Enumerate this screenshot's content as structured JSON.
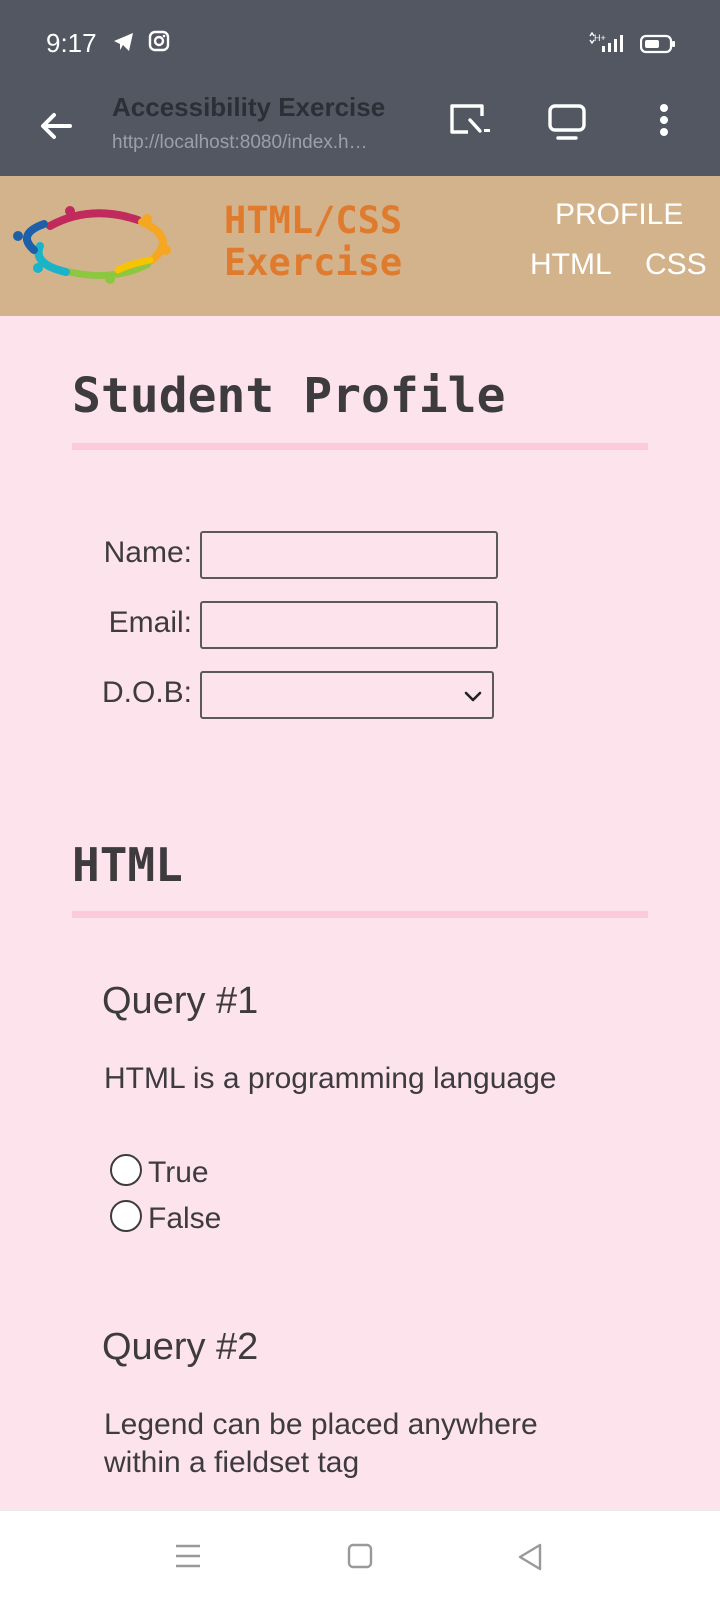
{
  "status_bar": {
    "time": "9:17",
    "icons": [
      "telegram-icon",
      "instagram-icon",
      "signal-icon",
      "battery-icon"
    ]
  },
  "browser": {
    "title": "Accessibility Exercise",
    "url": "http://localhost:8080/index.h…",
    "icons": [
      "back-arrow-icon",
      "cast-icon",
      "tab-switcher-icon",
      "more-vert-icon"
    ]
  },
  "site_header": {
    "brand_line1": "HTML/CSS",
    "brand_line2": "Exercise",
    "nav": {
      "profile": "PROFILE",
      "html": "HTML",
      "css": "CSS"
    }
  },
  "profile": {
    "heading": "Student Profile",
    "name_label": "Name:",
    "name_value": "",
    "email_label": "Email:",
    "email_value": "",
    "dob_label": "D.O.B:",
    "dob_value": ""
  },
  "html_section": {
    "heading": "HTML",
    "queries": [
      {
        "title": "Query #1",
        "text": "HTML is a programming language",
        "options": [
          "True",
          "False"
        ]
      },
      {
        "title": "Query #2",
        "text_line1": "Legend can be placed anywhere",
        "text_line2": "within a fieldset tag"
      }
    ]
  },
  "colors": {
    "page_bg": "#fde4ec",
    "bar_bg": "#535762",
    "header_bg": "#d3b38c",
    "brand": "#e07b2e",
    "rule": "#fdcadb"
  }
}
